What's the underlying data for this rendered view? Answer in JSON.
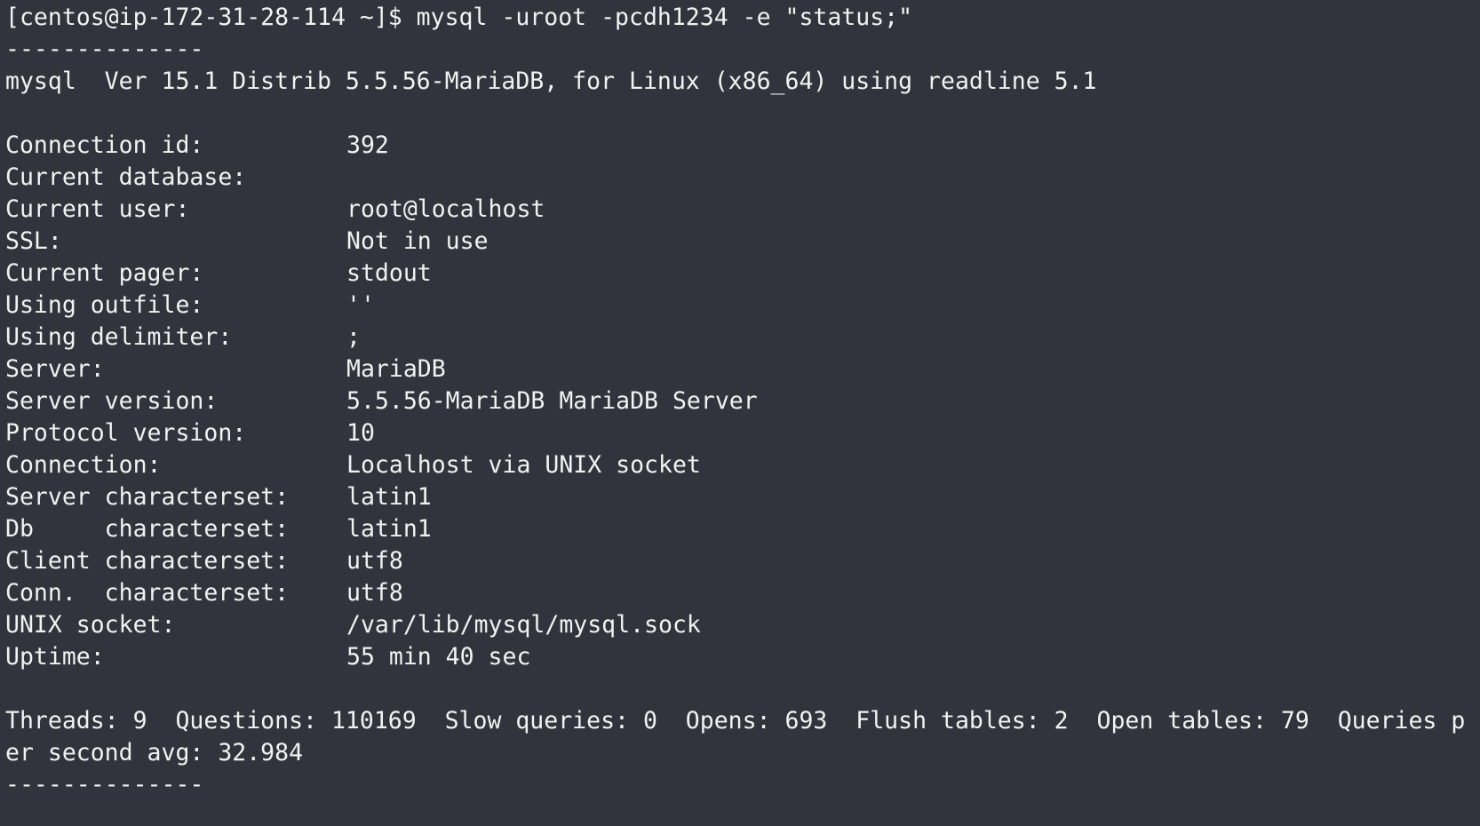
{
  "terminal": {
    "prompt_line": "[centos@ip-172-31-28-114 ~]$ mysql -uroot -pcdh1234 -e \"status;\"",
    "separator": "--------------",
    "version_line": "mysql  Ver 15.1 Distrib 5.5.56-MariaDB, for Linux (x86_64) using readline 5.1",
    "status_rows": [
      {
        "key": "Connection id:",
        "value": "392"
      },
      {
        "key": "Current database:",
        "value": ""
      },
      {
        "key": "Current user:",
        "value": "root@localhost"
      },
      {
        "key": "SSL:",
        "value": "Not in use"
      },
      {
        "key": "Current pager:",
        "value": "stdout"
      },
      {
        "key": "Using outfile:",
        "value": "''"
      },
      {
        "key": "Using delimiter:",
        "value": ";"
      },
      {
        "key": "Server:",
        "value": "MariaDB"
      },
      {
        "key": "Server version:",
        "value": "5.5.56-MariaDB MariaDB Server"
      },
      {
        "key": "Protocol version:",
        "value": "10"
      },
      {
        "key": "Connection:",
        "value": "Localhost via UNIX socket"
      },
      {
        "key": "Server characterset:",
        "value": "latin1"
      },
      {
        "key": "Db     characterset:",
        "value": "latin1"
      },
      {
        "key": "Client characterset:",
        "value": "utf8"
      },
      {
        "key": "Conn.  characterset:",
        "value": "utf8"
      },
      {
        "key": "UNIX socket:",
        "value": "/var/lib/mysql/mysql.sock"
      },
      {
        "key": "Uptime:",
        "value": "55 min 40 sec"
      }
    ],
    "stats_line_1": "Threads: 9  Questions: 110169  Slow queries: 0  Opens: 693  Flush tables: 2  Open tables: 79  Queries p",
    "stats_line_2": "er second avg: 32.984",
    "end_separator": "--------------"
  }
}
